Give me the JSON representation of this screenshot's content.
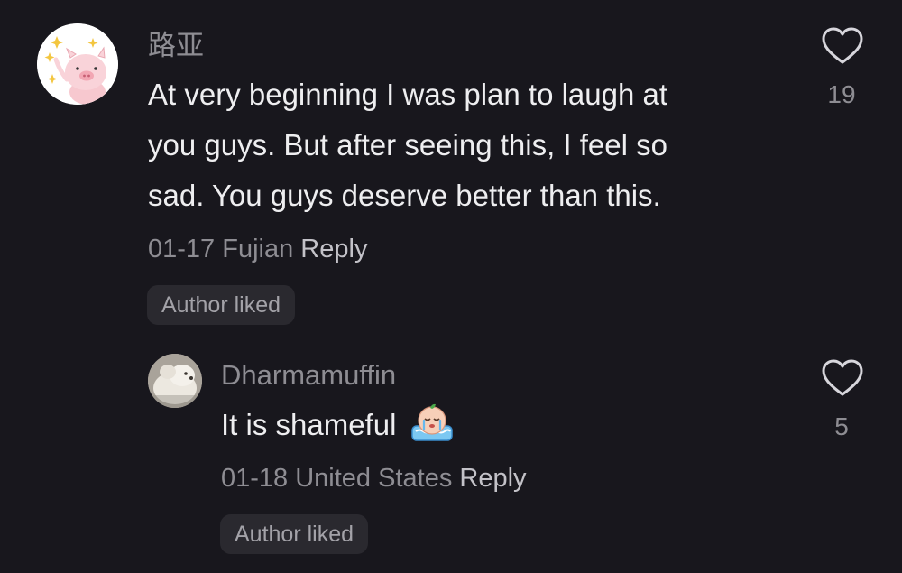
{
  "comments": [
    {
      "username": "路亚",
      "text_lines": [
        "At very beginning I was plan to laugh at",
        "you guys. But after seeing this,  I feel so",
        "sad. You guys deserve better than this."
      ],
      "date": "01-17",
      "location": "Fujian",
      "reply_label": "Reply",
      "badge": "Author liked",
      "likes": "19",
      "avatar_icon": "pig-avatar-icon",
      "like_icon": "heart-outline-icon"
    },
    {
      "username": "Dharmamuffin",
      "text": "It is shameful",
      "emoji_icon": "crying-emoji-icon",
      "date": "01-18",
      "location": "United States",
      "reply_label": "Reply",
      "badge": "Author liked",
      "likes": "5",
      "avatar_icon": "dog-avatar-icon",
      "like_icon": "heart-outline-icon"
    }
  ]
}
